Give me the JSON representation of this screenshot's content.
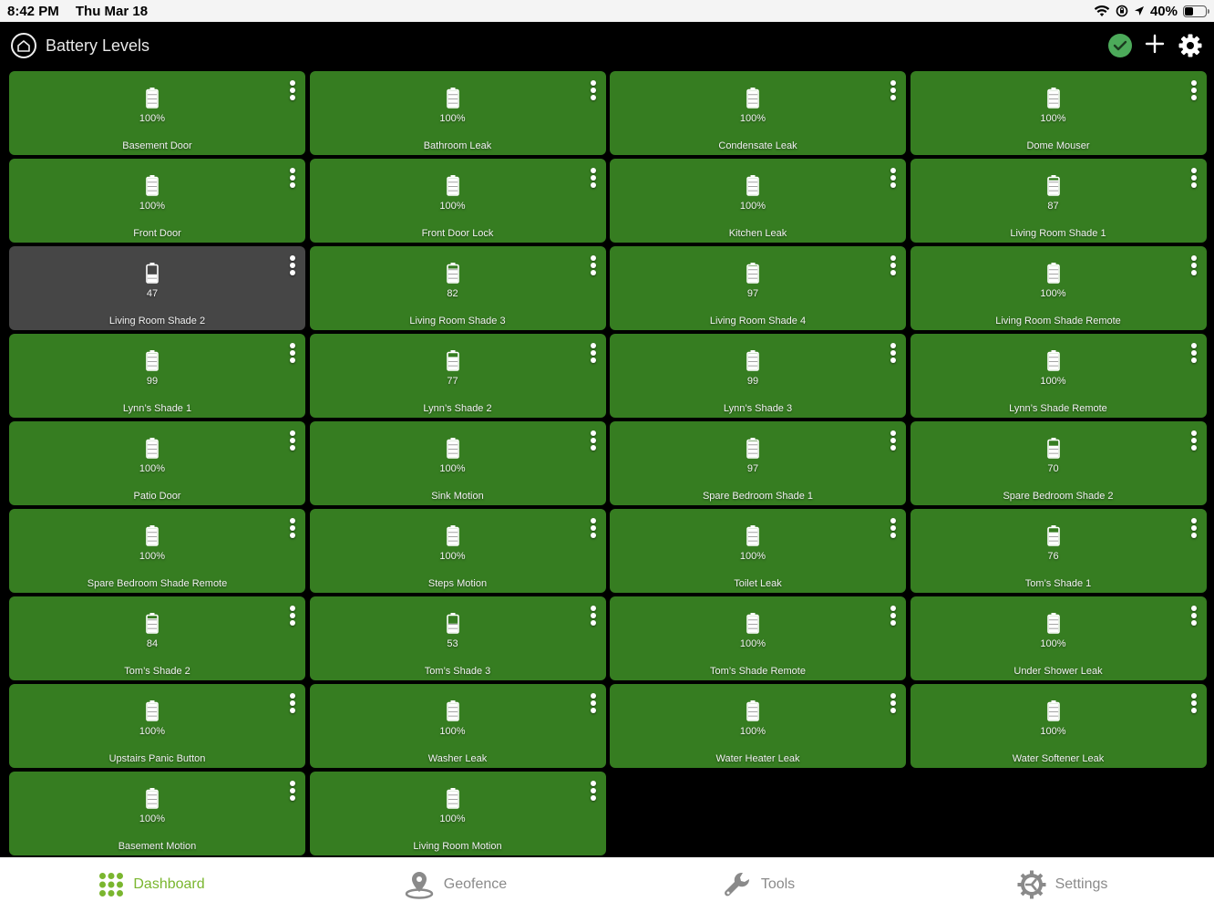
{
  "status_bar": {
    "time": "8:42 PM",
    "date": "Thu Mar 18",
    "battery_percent": "40%",
    "battery_level": 0.4
  },
  "header": {
    "title": "Battery Levels",
    "icons": [
      "home-icon",
      "check-circle-icon",
      "plus-icon",
      "gear-icon"
    ]
  },
  "colors": {
    "tile_ok": "#367d21",
    "tile_low": "#464646",
    "tab_active": "#7ab62f",
    "tab_inactive": "#8a8a8a",
    "check": "#4caa5a"
  },
  "tiles": [
    {
      "name": "Basement Door",
      "value": "100%",
      "level": 100,
      "low": false
    },
    {
      "name": "Bathroom Leak",
      "value": "100%",
      "level": 100,
      "low": false
    },
    {
      "name": "Condensate Leak",
      "value": "100%",
      "level": 100,
      "low": false
    },
    {
      "name": "Dome Mouser",
      "value": "100%",
      "level": 100,
      "low": false
    },
    {
      "name": "Front Door",
      "value": "100%",
      "level": 100,
      "low": false
    },
    {
      "name": "Front Door Lock",
      "value": "100%",
      "level": 100,
      "low": false
    },
    {
      "name": "Kitchen Leak",
      "value": "100%",
      "level": 100,
      "low": false
    },
    {
      "name": "Living Room Shade 1",
      "value": "87",
      "level": 87,
      "low": false
    },
    {
      "name": "Living Room Shade 2",
      "value": "47",
      "level": 47,
      "low": true
    },
    {
      "name": "Living Room Shade 3",
      "value": "82",
      "level": 82,
      "low": false
    },
    {
      "name": "Living Room Shade 4",
      "value": "97",
      "level": 97,
      "low": false
    },
    {
      "name": "Living Room Shade Remote",
      "value": "100%",
      "level": 100,
      "low": false
    },
    {
      "name": "Lynn’s Shade 1",
      "value": "99",
      "level": 99,
      "low": false
    },
    {
      "name": "Lynn’s Shade 2",
      "value": "77",
      "level": 77,
      "low": false
    },
    {
      "name": "Lynn’s Shade 3",
      "value": "99",
      "level": 99,
      "low": false
    },
    {
      "name": "Lynn’s Shade Remote",
      "value": "100%",
      "level": 100,
      "low": false
    },
    {
      "name": "Patio Door",
      "value": "100%",
      "level": 100,
      "low": false
    },
    {
      "name": "Sink Motion",
      "value": "100%",
      "level": 100,
      "low": false
    },
    {
      "name": "Spare Bedroom Shade 1",
      "value": "97",
      "level": 97,
      "low": false
    },
    {
      "name": "Spare Bedroom Shade 2",
      "value": "70",
      "level": 70,
      "low": false
    },
    {
      "name": "Spare Bedroom Shade Remote",
      "value": "100%",
      "level": 100,
      "low": false
    },
    {
      "name": "Steps Motion",
      "value": "100%",
      "level": 100,
      "low": false
    },
    {
      "name": "Toilet Leak",
      "value": "100%",
      "level": 100,
      "low": false
    },
    {
      "name": "Tom’s Shade 1",
      "value": "76",
      "level": 76,
      "low": false
    },
    {
      "name": "Tom’s Shade 2",
      "value": "84",
      "level": 84,
      "low": false
    },
    {
      "name": "Tom’s Shade 3",
      "value": "53",
      "level": 53,
      "low": false
    },
    {
      "name": "Tom’s Shade Remote",
      "value": "100%",
      "level": 100,
      "low": false
    },
    {
      "name": "Under Shower Leak",
      "value": "100%",
      "level": 100,
      "low": false
    },
    {
      "name": "Upstairs Panic Button",
      "value": "100%",
      "level": 100,
      "low": false
    },
    {
      "name": "Washer Leak",
      "value": "100%",
      "level": 100,
      "low": false
    },
    {
      "name": "Water Heater Leak",
      "value": "100%",
      "level": 100,
      "low": false
    },
    {
      "name": "Water Softener Leak",
      "value": "100%",
      "level": 100,
      "low": false
    },
    {
      "name": "Basement Motion",
      "value": "100%",
      "level": 100,
      "low": false
    },
    {
      "name": "Living Room Motion",
      "value": "100%",
      "level": 100,
      "low": false
    }
  ],
  "tabs": [
    {
      "label": "Dashboard",
      "icon": "grid-dots-icon",
      "active": true
    },
    {
      "label": "Geofence",
      "icon": "location-pin-icon",
      "active": false
    },
    {
      "label": "Tools",
      "icon": "wrench-icon",
      "active": false
    },
    {
      "label": "Settings",
      "icon": "settings-gear-icon",
      "active": false
    }
  ]
}
